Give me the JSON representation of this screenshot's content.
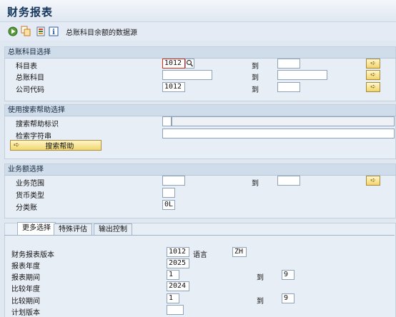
{
  "title": "财务报表",
  "toolbar": {
    "items": [
      {
        "icon": "execute-icon"
      },
      {
        "icon": "copy-variant-icon"
      },
      {
        "icon": "list-icon"
      },
      {
        "icon": "info-icon"
      }
    ],
    "data_source_label": "总账科目余额的数据源"
  },
  "account_section": {
    "heading": "总账科目选择",
    "rows": [
      {
        "label": "科目表",
        "from": "1012",
        "to_label": "到",
        "to": ""
      },
      {
        "label": "总账科目",
        "from": "",
        "to_label": "到",
        "to": ""
      },
      {
        "label": "公司代码",
        "from": "1012",
        "to_label": "到",
        "to": ""
      }
    ]
  },
  "search_help_section": {
    "heading": "使用搜索帮助选择",
    "search_help_id_label": "搜索帮助标识",
    "search_string_label": "检索字符串",
    "search_button_label": "搜索帮助"
  },
  "business_section": {
    "heading": "业务额选择",
    "business_area_label": "业务范围",
    "to_label": "到",
    "currency_type_label": "货币类型",
    "ledger_label": "分类账",
    "ledger_value": "0L"
  },
  "tabs": [
    {
      "label": "更多选择"
    },
    {
      "label": "特殊评估"
    },
    {
      "label": "输出控制"
    }
  ],
  "more_selection": {
    "fs_version_label": "财务报表版本",
    "fs_version_value": "1012",
    "language_label": "语言",
    "language_value": "ZH",
    "reporting_year_label": "报表年度",
    "reporting_year_value": "2025",
    "reporting_period_label": "报表期间",
    "reporting_period_from": "1",
    "reporting_period_to_label": "到",
    "reporting_period_to": "9",
    "comparison_year_label": "比较年度",
    "comparison_year_value": "2024",
    "comparison_period_label": "比较期间",
    "comparison_period_from": "1",
    "comparison_period_to_label": "到",
    "comparison_period_to": "9",
    "plan_version_label": "计划版本",
    "plan_version_value": ""
  }
}
